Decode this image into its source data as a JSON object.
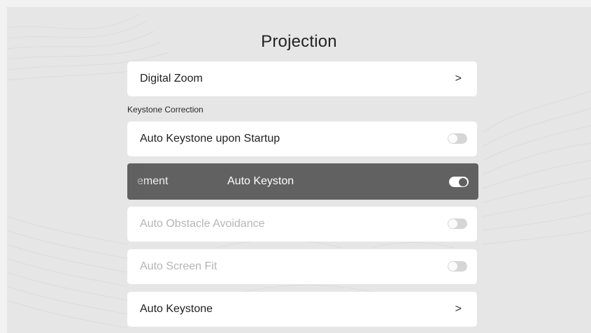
{
  "page": {
    "title": "Projection"
  },
  "rows": {
    "digital_zoom": {
      "label": "Digital Zoom",
      "chevron": ">"
    },
    "auto_keystone_startup": {
      "label": "Auto Keystone upon Startup",
      "enabled": true,
      "on": false
    },
    "auto_obstacle": {
      "label": "Auto Obstacle Avoidance",
      "enabled": false,
      "on": false
    },
    "auto_screen_fit": {
      "label": "Auto Screen Fit",
      "enabled": false,
      "on": false
    },
    "auto_keystone": {
      "label": "Auto Keystone",
      "chevron": ">"
    }
  },
  "section": {
    "keystone_label": "Keystone Correction"
  },
  "toast": {
    "left_text": "ement",
    "mid_text": "Auto Keyston",
    "toggle_on": true
  },
  "colors": {
    "background": "#e6e6e6",
    "card": "#ffffff",
    "toast_bg": "#616161",
    "disabled_text": "#b5b5b5"
  }
}
